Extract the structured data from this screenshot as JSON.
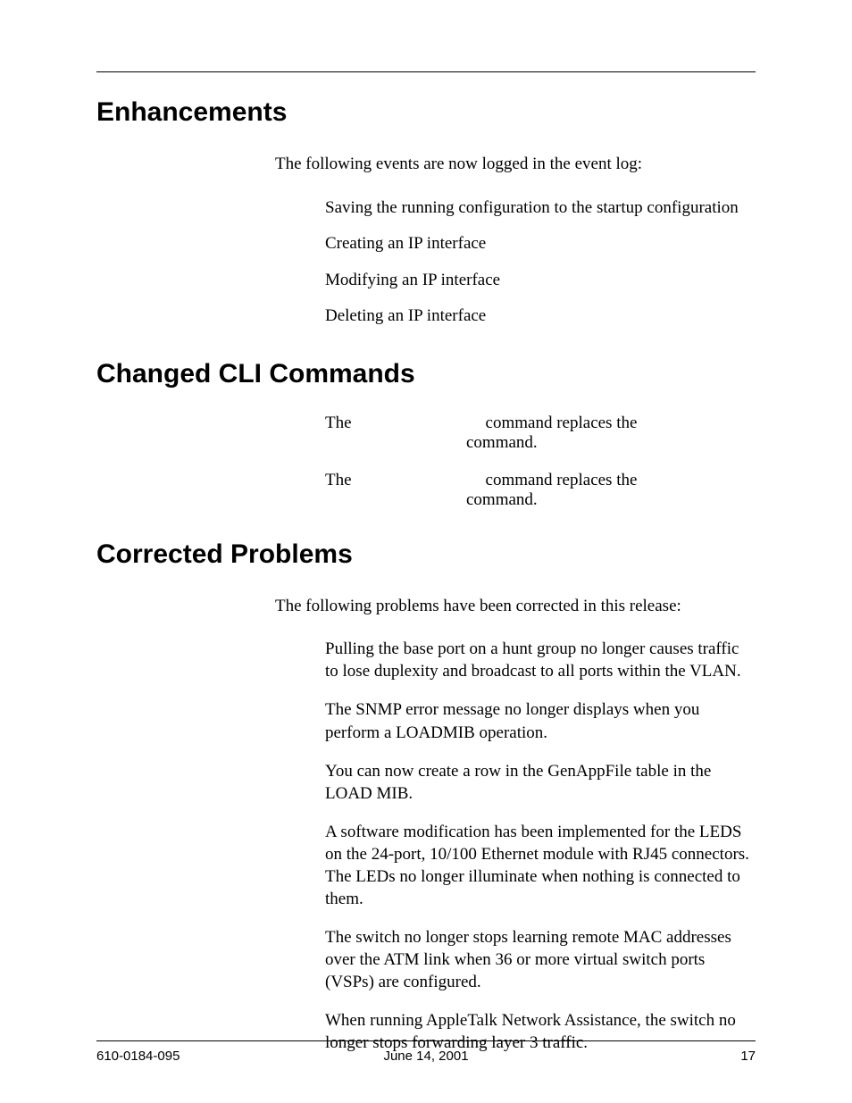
{
  "sections": {
    "enhancements": {
      "title": "Enhancements",
      "intro": "The following events are now logged in the event log:",
      "items": [
        "Saving the running configuration to the startup configuration",
        "Creating an IP interface",
        "Modifying an IP interface",
        "Deleting an IP interface"
      ]
    },
    "changed_cli": {
      "title": "Changed CLI Commands",
      "items": [
        {
          "pre": "The",
          "mid": "command replaces the",
          "post": "command."
        },
        {
          "pre": "The",
          "mid": "command replaces the",
          "post": "command."
        }
      ]
    },
    "corrected": {
      "title": "Corrected Problems",
      "intro": "The following problems have been corrected in this release:",
      "items": [
        "Pulling the base port on a hunt group no longer causes traffic to lose duplexity and broadcast to all ports within the VLAN.",
        "The SNMP error message no longer displays when you perform a LOADMIB operation.",
        "You can now create a row in the GenAppFile table in the LOAD MIB.",
        "A software modification has been implemented for the LEDS on the 24-port, 10/100 Ethernet module with RJ45 connectors. The LEDs no longer illuminate when nothing is connected to them.",
        "The switch no longer stops learning remote MAC addresses over the ATM link when 36 or more virtual switch ports (VSPs) are configured.",
        "When running AppleTalk Network Assistance, the switch no longer stops forwarding layer 3 traffic."
      ]
    }
  },
  "footer": {
    "doc_id": "610-0184-095",
    "date": "June 14, 2001",
    "page": "17"
  }
}
